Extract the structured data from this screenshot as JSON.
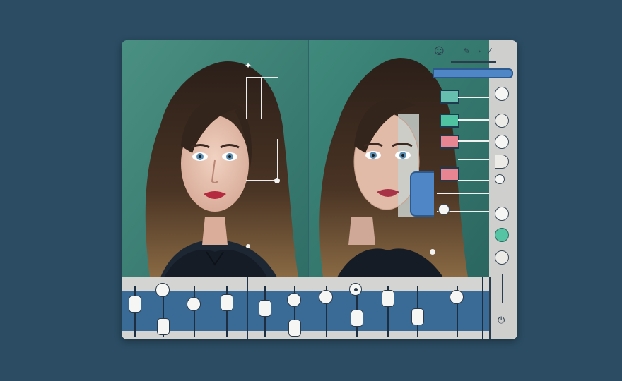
{
  "editor": {
    "panels": [
      {
        "name": "original-photo"
      },
      {
        "name": "edited-photo"
      }
    ],
    "colors": {
      "background": "#2b4c63",
      "canvas": "#3f8477",
      "accent_blue": "#4f86c6",
      "swatch_teal": "#4fc3a1",
      "swatch_pink": "#e88593",
      "swatch_green": "#66bfae"
    },
    "rail_icons": [
      "user-icon",
      "pencil-icon",
      "chevron-right-icon",
      "slash-icon"
    ],
    "bottom_icons": [
      "power-icon"
    ]
  },
  "sliders": {
    "channels": [
      {
        "level": 0.25
      },
      {
        "level": 0.55
      },
      {
        "level": 0.3
      },
      {
        "level": 0.35
      },
      {
        "level": 0.5
      },
      {
        "level": 0.8
      },
      {
        "level": 0.2
      },
      {
        "level": 0.65
      },
      {
        "level": 0.25
      },
      {
        "level": 0.6
      },
      {
        "level": 0.3
      }
    ]
  }
}
